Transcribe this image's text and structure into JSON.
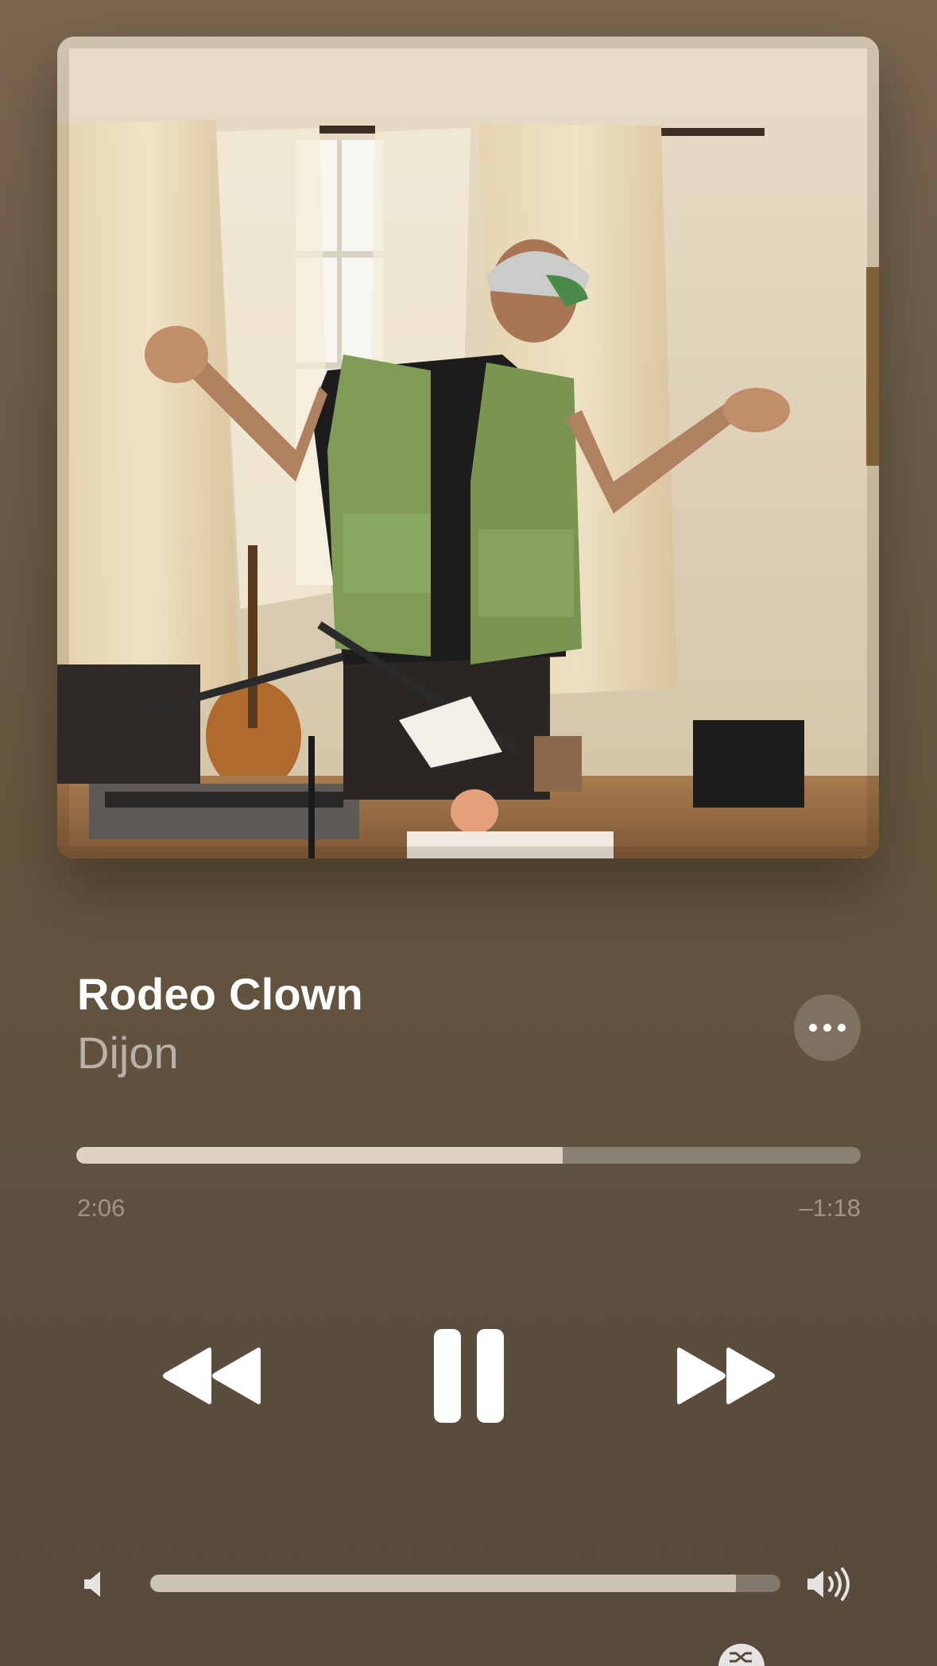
{
  "now_playing": {
    "title": "Rodeo Clown",
    "artist": "Dijon",
    "artwork_icon": "album-artwork"
  },
  "progress": {
    "elapsed": "2:06",
    "remaining": "–1:18",
    "fraction": 0.62
  },
  "controls": {
    "rewind_icon": "rewind-icon",
    "pause_icon": "pause-icon",
    "forward_icon": "fast-forward-icon",
    "more_icon": "ellipsis-icon",
    "shuffle_icon": "shuffle-icon"
  },
  "volume": {
    "level": 0.93,
    "low_icon": "speaker-low-icon",
    "high_icon": "speaker-high-icon"
  },
  "colors": {
    "background": "#6a5945",
    "accent": "#ffffff"
  }
}
